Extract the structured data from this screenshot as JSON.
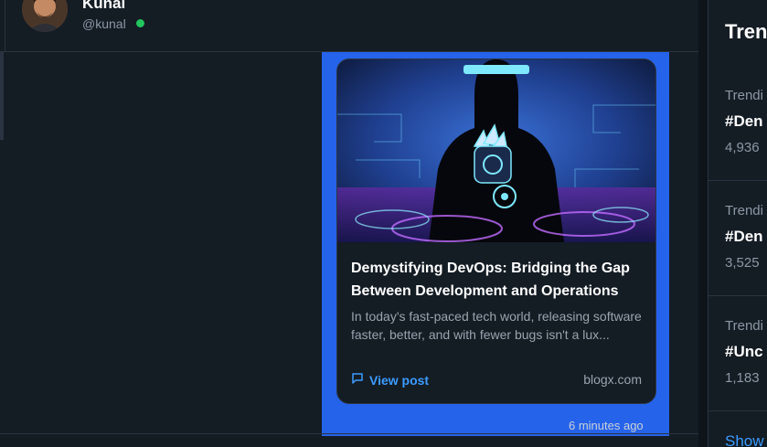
{
  "chat": {
    "user_name": "Kunal",
    "user_handle": "@kunal",
    "status_color": "#22c55e"
  },
  "message": {
    "bubble_color": "#2563eb",
    "timestamp": "6 minutes ago",
    "link_card": {
      "image_alt": "Cyber figure with robotic hand",
      "title": "Demystifying DevOps: Bridging the Gap Between Development and Operations",
      "excerpt": "In today's fast-paced tech world, releasing software faster, better, and with fewer bugs isn't a lux...",
      "action_label": "View post",
      "action_icon": "chat-bubble-icon",
      "domain": "blogx.com"
    }
  },
  "trends": {
    "title": "Tren",
    "items": [
      {
        "context": "Trendi",
        "tag": "#Den",
        "count": "4,936"
      },
      {
        "context": "Trendi",
        "tag": "#Den",
        "count": "3,525"
      },
      {
        "context": "Trendi",
        "tag": "#Unc",
        "count": "1,183"
      }
    ],
    "show_more": "Show"
  },
  "colors": {
    "background": "#141c24",
    "accent": "#3b9cff",
    "border": "#2a3440"
  }
}
